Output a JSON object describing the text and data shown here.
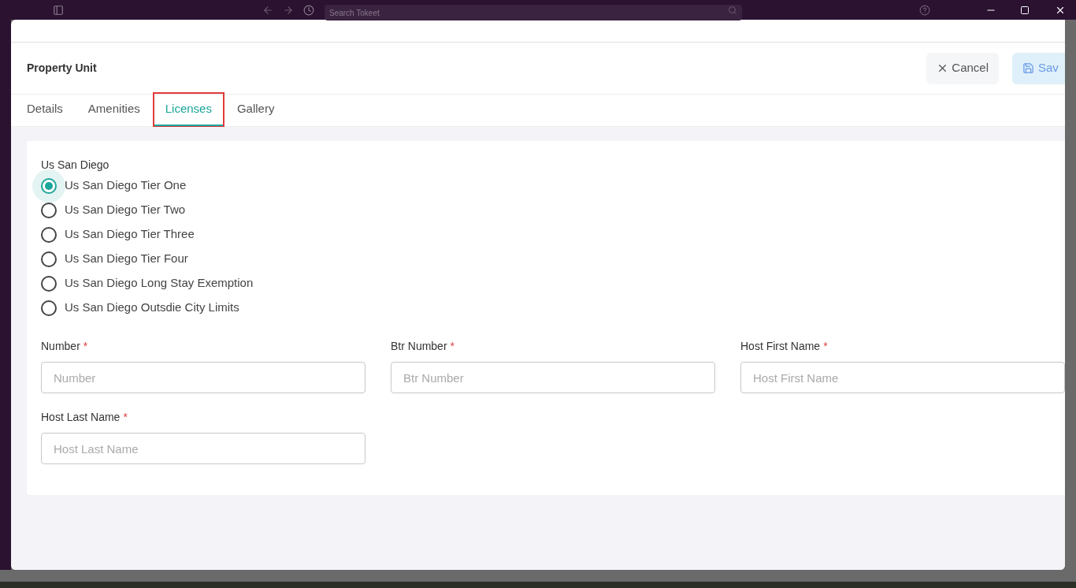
{
  "top_bar": {
    "search": {
      "placeholder": "Search Tokeet"
    }
  },
  "modal": {
    "title": "Property Unit",
    "cancel_button": "Cancel",
    "save_button": "Sav",
    "tabs": [
      {
        "label": "Details",
        "selected": false
      },
      {
        "label": "Amenities",
        "selected": false
      },
      {
        "label": "Licenses",
        "selected": true
      },
      {
        "label": "Gallery",
        "selected": false
      }
    ],
    "license_group": {
      "title": "Us San Diego",
      "options": [
        {
          "label": "Us San Diego Tier One",
          "selected": true
        },
        {
          "label": "Us San Diego Tier Two",
          "selected": false
        },
        {
          "label": "Us San Diego Tier Three",
          "selected": false
        },
        {
          "label": "Us San Diego Tier Four",
          "selected": false
        },
        {
          "label": "Us San Diego Long Stay Exemption",
          "selected": false
        },
        {
          "label": "Us San Diego Outsdie City Limits",
          "selected": false
        }
      ]
    },
    "fields": [
      {
        "label": "Number",
        "required_mark": "*",
        "placeholder": "Number"
      },
      {
        "label": "Btr Number",
        "required_mark": "*",
        "placeholder": "Btr Number"
      },
      {
        "label": "Host First Name",
        "required_mark": "*",
        "placeholder": "Host First Name"
      },
      {
        "label": "Host Last Name",
        "required_mark": "*",
        "placeholder": "Host Last Name"
      }
    ]
  }
}
